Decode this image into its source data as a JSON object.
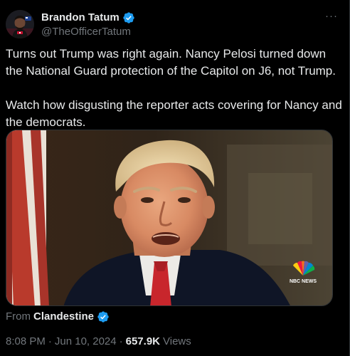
{
  "author": {
    "display_name": "Brandon Tatum",
    "handle": "@TheOfficerTatum",
    "verified_icon": "verified-badge-icon",
    "more_icon": "more-options-icon",
    "more_glyph": "···"
  },
  "tweet": {
    "paragraphs": [
      "Turns out Trump was right again. Nancy Pelosi turned down the National Guard protection of the Capitol on J6, not Trump.",
      "Watch how disgusting the reporter acts covering for Nancy and the democrats."
    ]
  },
  "media": {
    "type": "video",
    "watermark_text": "NBC NEWS"
  },
  "attribution": {
    "from_label": "From",
    "from_account": "Clandestine"
  },
  "meta": {
    "time": "8:08 PM",
    "separator": "·",
    "date": "Jun 10, 2024",
    "views_count": "657.9K",
    "views_label": "Views"
  },
  "colors": {
    "background": "#000000",
    "text_primary": "#e7e9ea",
    "text_secondary": "#71767b",
    "verified_blue": "#1d9bf0",
    "border": "#2f3336"
  }
}
